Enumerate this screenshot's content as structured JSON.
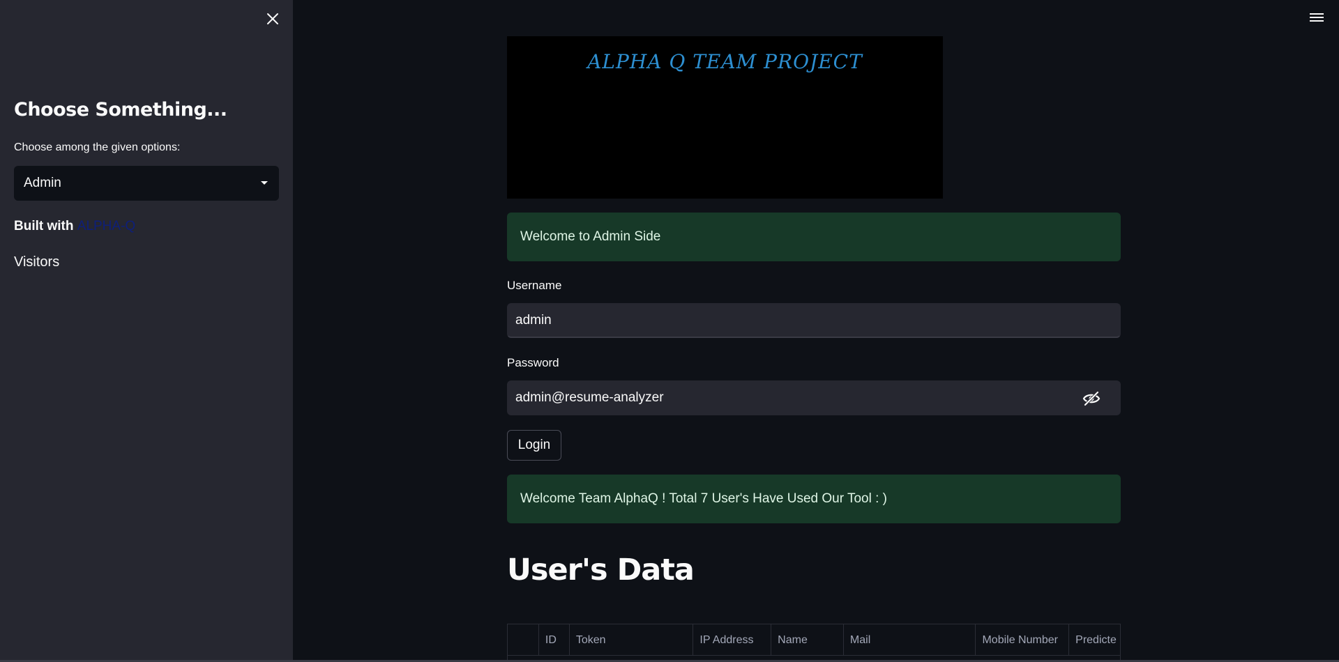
{
  "sidebar": {
    "title": "Choose Something...",
    "select_label": "Choose among the given options:",
    "select_value": "Admin",
    "built_with_prefix": "Built with ",
    "built_with_link": "ALPHA-Q",
    "visitors": "Visitors"
  },
  "banner": {
    "text": "ALPHA Q TEAM PROJECT"
  },
  "main": {
    "welcome_message": "Welcome to Admin Side",
    "username_label": "Username",
    "username_value": "admin",
    "password_label": "Password",
    "password_value": "admin@resume-analyzer",
    "login_label": "Login",
    "success_message": "Welcome Team AlphaQ ! Total 7 User's Have Used Our Tool : )",
    "section_heading": "User's Data"
  },
  "table": {
    "columns": [
      "",
      "ID",
      "Token",
      "IP Address",
      "Name",
      "Mail",
      "Mobile Number",
      "Predicte"
    ]
  },
  "colors": {
    "sidebar_bg": "#262730",
    "app_bg": "#0e1117",
    "success_bg": "#173928",
    "banner_text": "#2d8fd1",
    "link": "#0e1f7a"
  },
  "icons": {
    "close": "close-icon",
    "menu": "hamburger-menu-icon",
    "caret": "chevron-down-icon",
    "password_toggle": "eye-slash-icon"
  }
}
